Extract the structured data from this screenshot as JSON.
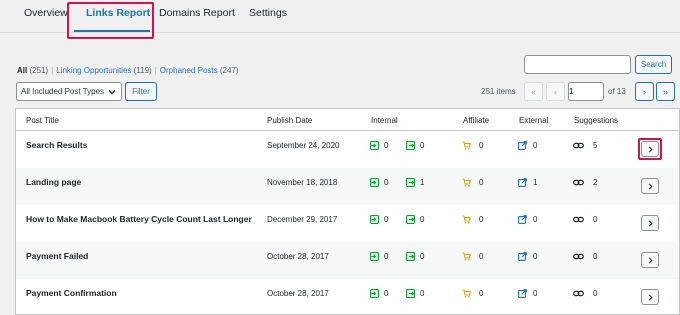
{
  "tabs": [
    {
      "label": "Overview"
    },
    {
      "label": "Links Report"
    },
    {
      "label": "Domains Report"
    },
    {
      "label": "Settings"
    }
  ],
  "filters": {
    "all": {
      "label": "All",
      "count": "(251)"
    },
    "opportunities": {
      "label": "Linking Opportunities",
      "count": "(119)"
    },
    "orphaned": {
      "label": "Orphaned Posts",
      "count": "(247)"
    },
    "separator": "|"
  },
  "search": {
    "button_label": "Search",
    "value": ""
  },
  "post_type_select": {
    "selected": "All Included Post Types"
  },
  "filter_button_label": "Filter",
  "pagination": {
    "items_label": "251 items",
    "first": "«",
    "prev": "‹",
    "current_page": "1",
    "of_label": "of 13",
    "next": "›",
    "last": "»"
  },
  "table": {
    "columns": [
      "Post Title",
      "Publish Date",
      "Internal",
      "Affiliate",
      "External",
      "Suggestions"
    ],
    "rows": [
      {
        "title": "Search Results",
        "date": "September 24, 2020",
        "internal_in": "0",
        "internal_out": "0",
        "affiliate": "0",
        "external": "0",
        "suggestions": "5"
      },
      {
        "title": "Landing page",
        "date": "November 18, 2018",
        "internal_in": "0",
        "internal_out": "1",
        "affiliate": "0",
        "external": "1",
        "suggestions": "2"
      },
      {
        "title": "How to Make Macbook Battery Cycle Count Last Longer",
        "date": "December 29, 2017",
        "internal_in": "0",
        "internal_out": "0",
        "affiliate": "0",
        "external": "0",
        "suggestions": "0"
      },
      {
        "title": "Payment Failed",
        "date": "October 28, 2017",
        "internal_in": "0",
        "internal_out": "0",
        "affiliate": "0",
        "external": "0",
        "suggestions": "0"
      },
      {
        "title": "Payment Confirmation",
        "date": "October 28, 2017",
        "internal_in": "0",
        "internal_out": "0",
        "affiliate": "0",
        "external": "0",
        "suggestions": "0"
      }
    ]
  },
  "colors": {
    "accent": "#2271b1",
    "highlight": "#d6114c",
    "internal_icon": "#00a32a",
    "affiliate_icon": "#dba617",
    "external_icon": "#2271b1"
  },
  "icons": {
    "internal_in": "inbound-link-icon",
    "internal_out": "outbound-link-icon",
    "affiliate": "cart-icon",
    "external": "external-link-icon",
    "suggestions": "link-icon",
    "row_action": "chevron-right-icon"
  }
}
